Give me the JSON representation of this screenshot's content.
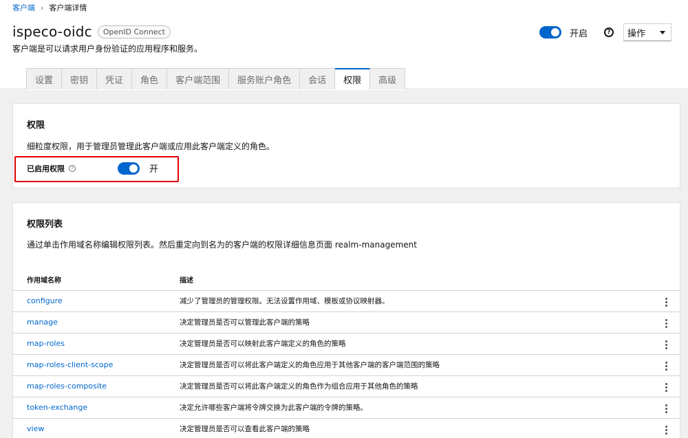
{
  "breadcrumb": {
    "root": "客户端",
    "current": "客户端详情"
  },
  "header": {
    "title": "ispeco-oidc",
    "badge": "OpenID Connect",
    "subtitle": "客户端是可以请求用户身份验证的应用程序和服务。",
    "enabled_label": "开启",
    "enabled": true,
    "actions_label": "操作"
  },
  "tabs": [
    {
      "label": "设置",
      "active": false
    },
    {
      "label": "密钥",
      "active": false
    },
    {
      "label": "凭证",
      "active": false
    },
    {
      "label": "角色",
      "active": false
    },
    {
      "label": "客户端范围",
      "active": false
    },
    {
      "label": "服务账户角色",
      "active": false
    },
    {
      "label": "会话",
      "active": false
    },
    {
      "label": "权限",
      "active": true
    },
    {
      "label": "高级",
      "active": false
    }
  ],
  "permissions": {
    "title": "权限",
    "description": "细粒度权限，用于管理员管理此客户端或应用此客户端定义的角色。",
    "enabled_label": "已启用权限",
    "enabled_state": "开",
    "enabled": true
  },
  "permission_list": {
    "title": "权限列表",
    "description": "通过单击作用域名称编辑权限列表。然后重定向到名为的客户端的权限详细信息页面 realm-management",
    "columns": [
      "作用域名称",
      "描述"
    ],
    "rows": [
      {
        "name": "configure",
        "desc": "减少了管理员的管理权限。无法设置作用域、模板或协议映射器。"
      },
      {
        "name": "manage",
        "desc": "决定管理员是否可以管理此客户端的策略"
      },
      {
        "name": "map-roles",
        "desc": "决定管理员是否可以映射此客户端定义的角色的策略"
      },
      {
        "name": "map-roles-client-scope",
        "desc": "决定管理员是否可以将此客户端定义的角色应用于其他客户端的客户端范围的策略"
      },
      {
        "name": "map-roles-composite",
        "desc": "决定管理员是否可以将此客户端定义的角色作为组合应用于其他角色的策略"
      },
      {
        "name": "token-exchange",
        "desc": "决定允许哪些客户端将令牌交换为此客户端的令牌的策略。"
      },
      {
        "name": "view",
        "desc": "决定管理员是否可以查看此客户端的策略"
      }
    ]
  },
  "colors": {
    "accent": "#0066cc",
    "highlight": "#e00000",
    "background": "#f0f0f0"
  }
}
